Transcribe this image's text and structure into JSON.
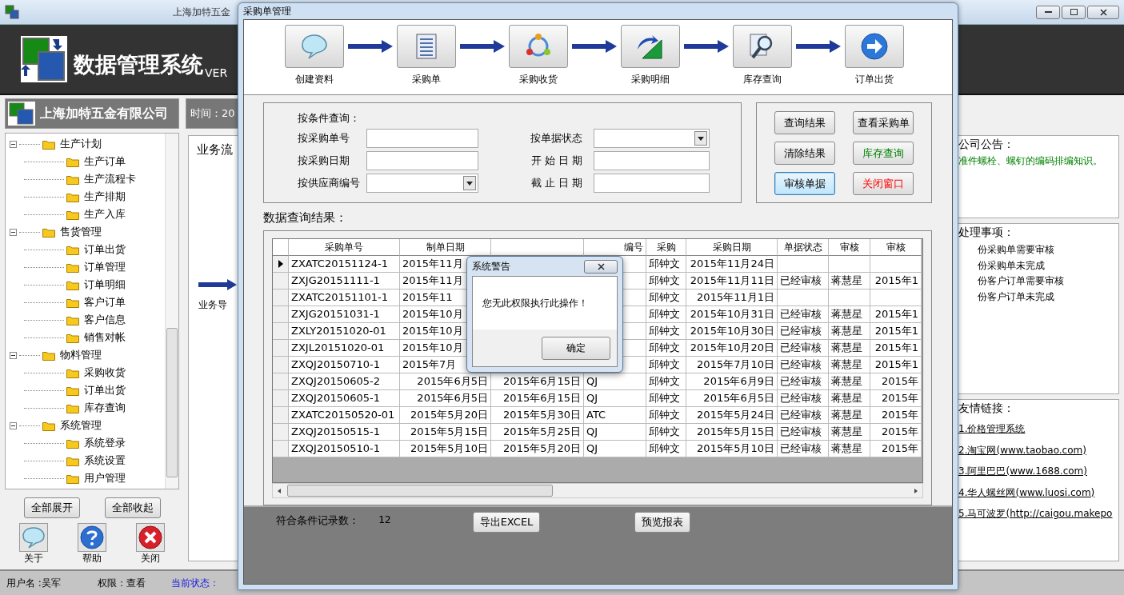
{
  "main_window": {
    "title": "上海加特五金",
    "app_name": "数据管理系统",
    "version": "VER",
    "company": "上海加特五金有限公司",
    "time_label": "时间：20",
    "flow_title": "业务流",
    "flow_step": "业务导",
    "tree": [
      {
        "label": "生产计划",
        "expanded": true,
        "children": [
          {
            "label": "生产订单"
          },
          {
            "label": "生产流程卡"
          },
          {
            "label": "生产排期"
          },
          {
            "label": "生产入库"
          }
        ]
      },
      {
        "label": "售货管理",
        "expanded": true,
        "children": [
          {
            "label": "订单出货"
          },
          {
            "label": "订单管理"
          },
          {
            "label": "订单明细"
          },
          {
            "label": "客户订单"
          },
          {
            "label": "客户信息"
          },
          {
            "label": "销售对帐"
          }
        ]
      },
      {
        "label": "物料管理",
        "expanded": true,
        "children": [
          {
            "label": "采购收货"
          },
          {
            "label": "订单出货"
          },
          {
            "label": "库存查询"
          }
        ]
      },
      {
        "label": "系统管理",
        "expanded": true,
        "children": [
          {
            "label": "系统登录"
          },
          {
            "label": "系统设置"
          },
          {
            "label": "用户管理"
          }
        ]
      }
    ],
    "tree_buttons": [
      "全部展开",
      "全部收起"
    ],
    "tool_buttons": [
      {
        "label": "关于",
        "kind": "about"
      },
      {
        "label": "帮助",
        "kind": "help"
      },
      {
        "label": "关闭",
        "kind": "close"
      }
    ],
    "notice": {
      "title": "公司公告：",
      "text": "准件螺栓、螺钉的编码排编知识。"
    },
    "todo": {
      "title": "处理事项：",
      "items": [
        "份采购单需要审核",
        "份采购单未完成",
        "份客户订单需要审核",
        "份客户订单未完成"
      ]
    },
    "links": {
      "title": "友情链接：",
      "items": [
        "1.价格管理系统",
        "2.淘宝网(www.taobao.com)",
        "3.阿里巴巴(www.1688.com)",
        "4.华人螺丝网(www.luosi.com)",
        "5.马可波罗(http://caigou.makepo"
      ]
    },
    "status_bar": {
      "user": "用户名 :吴军",
      "permission": "权限：查看",
      "state": "当前状态："
    }
  },
  "purchase_dialog": {
    "title": "采购单管理",
    "workflow": [
      {
        "label": "创建资料",
        "kind": "speech"
      },
      {
        "label": "采购单",
        "kind": "list"
      },
      {
        "label": "采购收货",
        "kind": "cycle"
      },
      {
        "label": "采购明细",
        "kind": "chart"
      },
      {
        "label": "库存查询",
        "kind": "search"
      },
      {
        "label": "订单出货",
        "kind": "next"
      }
    ],
    "query": {
      "title": "按条件查询：",
      "fields": [
        {
          "label": "按采购单号",
          "kind": "text"
        },
        {
          "label": "按单据状态",
          "kind": "select"
        },
        {
          "label": "按采购日期",
          "kind": "text"
        },
        {
          "label": "开 始 日 期",
          "kind": "text"
        },
        {
          "label": "按供应商编号",
          "kind": "select"
        },
        {
          "label": "截 止 日 期",
          "kind": "text"
        }
      ]
    },
    "actions": [
      {
        "label": "查询结果",
        "kind": "normal",
        "focused": false
      },
      {
        "label": "查看采购单",
        "kind": "normal",
        "focused": false
      },
      {
        "label": "清除结果",
        "kind": "normal",
        "focused": false
      },
      {
        "label": "库存查询",
        "kind": "green",
        "focused": false
      },
      {
        "label": "审核单据",
        "kind": "normal",
        "focused": true
      },
      {
        "label": "关闭窗口",
        "kind": "red",
        "focused": false
      }
    ],
    "results_title": "数据查询结果：",
    "table": {
      "columns": [
        "采购单号",
        "制单日期",
        null,
        "编号",
        "采购",
        "采购日期",
        "单据状态",
        "审核",
        "审核"
      ],
      "rows": [
        {
          "selected": true,
          "covered": true,
          "cells": [
            "ZXATC20151124-1",
            "2015年11月",
            null,
            null,
            "邱钟文",
            "2015年11月24日",
            null,
            null,
            null
          ]
        },
        {
          "selected": false,
          "covered": true,
          "cells": [
            "ZXJG20151111-1",
            "2015年11月",
            null,
            null,
            "邱钟文",
            "2015年11月11日",
            "已经审核",
            "蒋慧星",
            "2015年1"
          ]
        },
        {
          "selected": false,
          "covered": true,
          "cells": [
            "ZXATC20151101-1",
            "2015年11",
            null,
            null,
            "邱钟文",
            "2015年11月1日",
            null,
            null,
            null
          ]
        },
        {
          "selected": false,
          "covered": true,
          "cells": [
            "ZXJG20151031-1",
            "2015年10月",
            null,
            null,
            "邱钟文",
            "2015年10月31日",
            "已经审核",
            "蒋慧星",
            "2015年1"
          ]
        },
        {
          "selected": false,
          "covered": true,
          "cells": [
            "ZXLY20151020-01",
            "2015年10月",
            null,
            null,
            "邱钟文",
            "2015年10月30日",
            "已经审核",
            "蒋慧星",
            "2015年1"
          ]
        },
        {
          "selected": false,
          "covered": true,
          "cells": [
            "ZXJL20151020-01",
            "2015年10月",
            null,
            null,
            "邱钟文",
            "2015年10月20日",
            "已经审核",
            "蒋慧星",
            "2015年1"
          ]
        },
        {
          "selected": false,
          "covered": true,
          "cells": [
            "ZXQJ20150710-1",
            "2015年7月",
            null,
            null,
            "邱钟文",
            "2015年7月10日",
            "已经审核",
            "蒋慧星",
            "2015年1"
          ]
        },
        {
          "selected": false,
          "covered": false,
          "cells": [
            "ZXQJ20150605-2",
            "2015年6月5日",
            "2015年6月15日",
            "QJ",
            "邱钟文",
            "2015年6月9日",
            "已经审核",
            "蒋慧星",
            "2015年"
          ]
        },
        {
          "selected": false,
          "covered": false,
          "cells": [
            "ZXQJ20150605-1",
            "2015年6月5日",
            "2015年6月15日",
            "QJ",
            "邱钟文",
            "2015年6月5日",
            "已经审核",
            "蒋慧星",
            "2015年"
          ]
        },
        {
          "selected": false,
          "covered": false,
          "cells": [
            "ZXATC20150520-01",
            "2015年5月20日",
            "2015年5月30日",
            "ATC",
            "邱钟文",
            "2015年5月24日",
            "已经审核",
            "蒋慧星",
            "2015年"
          ]
        },
        {
          "selected": false,
          "covered": false,
          "cells": [
            "ZXQJ20150515-1",
            "2015年5月15日",
            "2015年5月25日",
            "QJ",
            "邱钟文",
            "2015年5月15日",
            "已经审核",
            "蒋慧星",
            "2015年"
          ]
        },
        {
          "selected": false,
          "covered": false,
          "cells": [
            "ZXQJ20150510-1",
            "2015年5月10日",
            "2015年5月20日",
            "QJ",
            "邱钟文",
            "2015年5月10日",
            "已经审核",
            "蒋慧星",
            "2015年"
          ]
        }
      ]
    },
    "count_label": "符合条件记录数：",
    "count": "12",
    "footer_buttons": [
      "导出EXCEL",
      "预览报表"
    ]
  },
  "alert": {
    "title": "系统警告",
    "message": "您无此权限执行此操作！",
    "button": "确定"
  }
}
